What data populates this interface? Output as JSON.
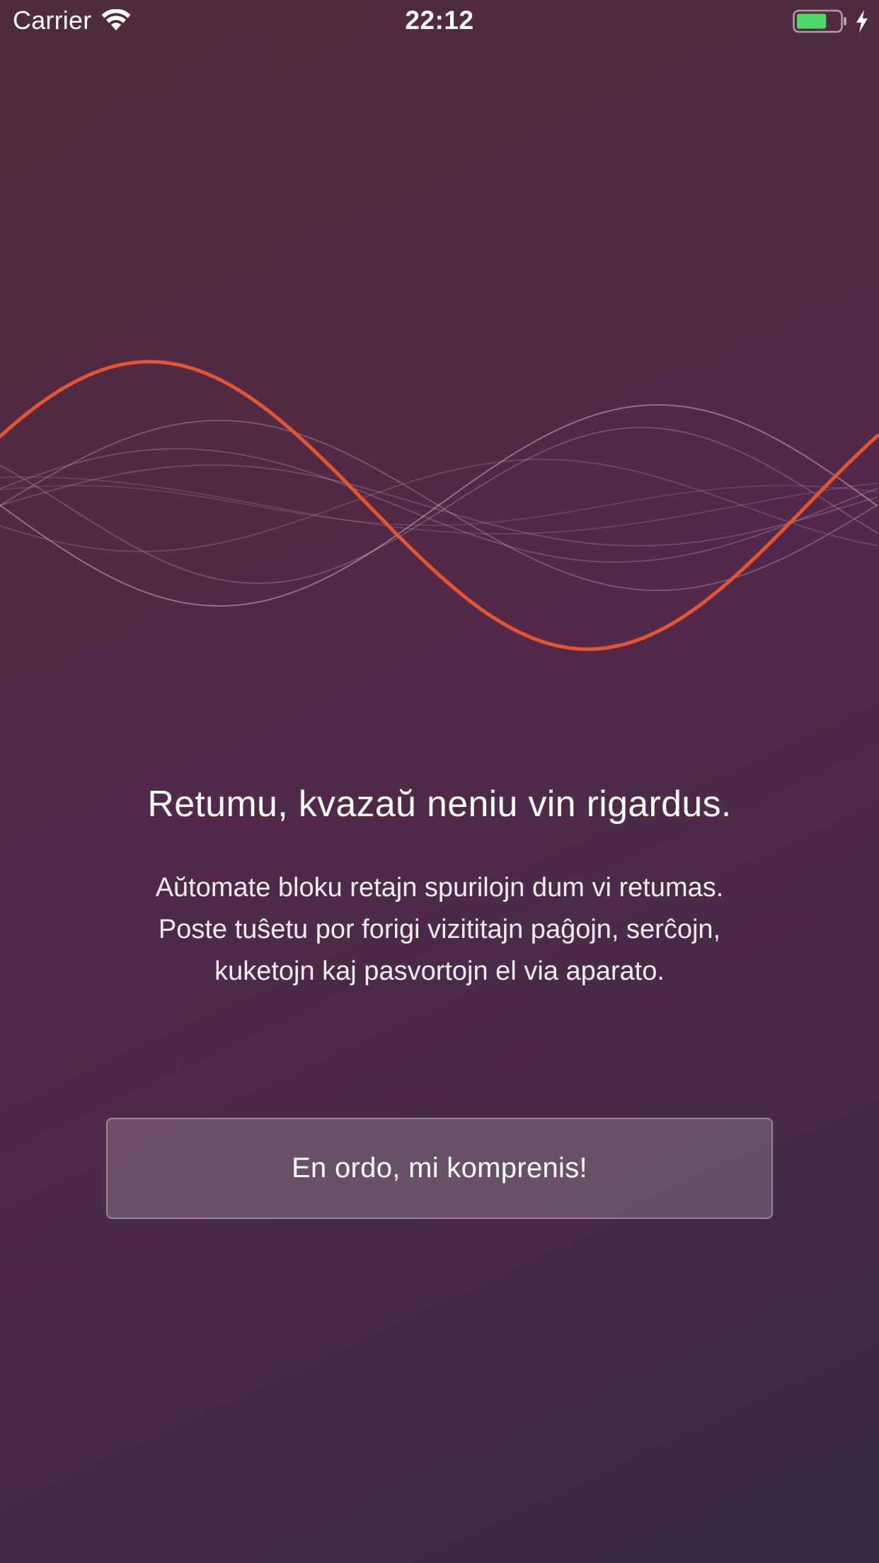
{
  "status_bar": {
    "carrier": "Carrier",
    "time": "22:12",
    "wifi_icon": "wifi-icon",
    "battery_icon": "battery-icon",
    "charging_icon": "bolt-icon",
    "battery_level": 0.7,
    "battery_color": "#4cd964"
  },
  "waveform": {
    "accent_color": "#e8552b",
    "line_color": "#c8c0c8"
  },
  "content": {
    "headline": "Retumu, kvazaŭ neniu vin rigardus.",
    "body_lines": [
      "Aŭtomate bloku retajn spurilojn dum vi retumas.",
      "Poste tuŝetu por forigi vizititajn paĝojn, serĉojn,",
      "kuketojn kaj pasvortojn el via aparato."
    ],
    "button_label": "En ordo, mi komprenis!"
  },
  "colors": {
    "background_top": "#4f2b3b",
    "background_bottom": "#3a2a45",
    "accent": "#e8552b"
  }
}
